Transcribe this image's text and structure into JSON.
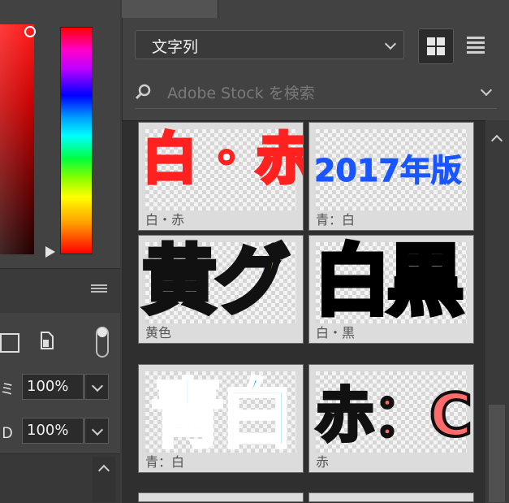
{
  "dropdown": {
    "value": "文字列"
  },
  "search": {
    "placeholder": "Adobe Stock を検索"
  },
  "left_panel": {
    "fields": [
      {
        "label": "ミ",
        "value": "100%"
      },
      {
        "label": "Ｄ",
        "value": "100%"
      }
    ]
  },
  "styles": [
    {
      "text": "白・赤",
      "caption": "白・赤"
    },
    {
      "text": "2017年版",
      "caption": "青：白"
    },
    {
      "text": "黄グ",
      "caption": "黄色"
    },
    {
      "text": "白黒",
      "caption": "白・黒"
    },
    {
      "text": "青白",
      "caption": "青：白"
    },
    {
      "text": "赤：C",
      "caption": "赤"
    }
  ],
  "colors": {
    "panel": "#424242",
    "grid_bg": "#2f2f2f",
    "red": "#ff2020",
    "blue": "#1a56ff",
    "yellow": "#fff200",
    "cyan": "#19b6ff",
    "salmon": "#ff6a6a"
  }
}
